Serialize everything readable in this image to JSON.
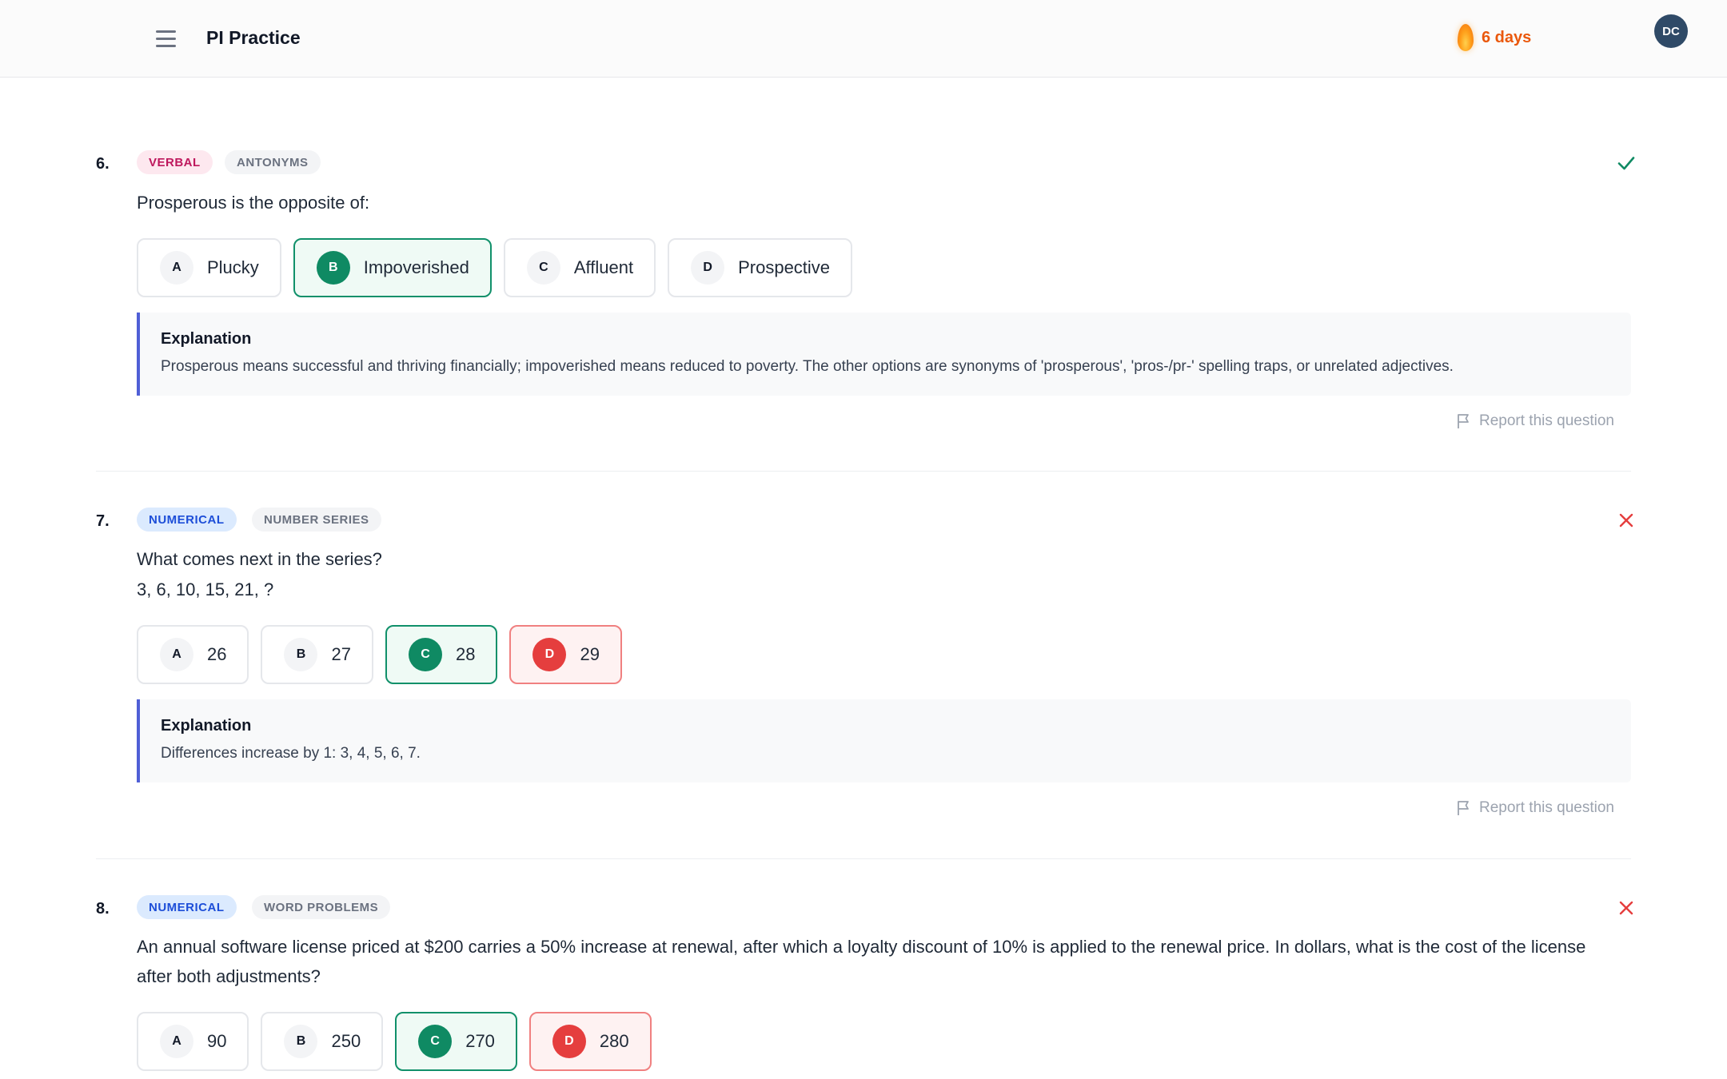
{
  "header": {
    "app_title": "PI Practice",
    "streak_text": "6 days",
    "avatar_initials": "DC"
  },
  "questions": [
    {
      "number": "6.",
      "category": "VERBAL",
      "subcategory": "ANTONYMS",
      "status": "correct",
      "text_lines": [
        "Prosperous is the opposite of:"
      ],
      "options": [
        {
          "letter": "A",
          "text": "Plucky",
          "state": "neutral"
        },
        {
          "letter": "B",
          "text": "Impoverished",
          "state": "correct"
        },
        {
          "letter": "C",
          "text": "Affluent",
          "state": "neutral"
        },
        {
          "letter": "D",
          "text": "Prospective",
          "state": "neutral"
        }
      ],
      "explanation_title": "Explanation",
      "explanation": "Prosperous means successful and thriving financially; impoverished means reduced to poverty. The other options are synonyms of 'prosperous', 'pros-/pr-' spelling traps, or unrelated adjectives.",
      "report_label": "Report this question"
    },
    {
      "number": "7.",
      "category": "NUMERICAL",
      "subcategory": "NUMBER SERIES",
      "status": "incorrect",
      "text_lines": [
        "What comes next in the series?",
        "3, 6, 10, 15, 21, ?"
      ],
      "options": [
        {
          "letter": "A",
          "text": "26",
          "state": "neutral"
        },
        {
          "letter": "B",
          "text": "27",
          "state": "neutral"
        },
        {
          "letter": "C",
          "text": "28",
          "state": "correct"
        },
        {
          "letter": "D",
          "text": "29",
          "state": "wrong"
        }
      ],
      "explanation_title": "Explanation",
      "explanation": "Differences increase by 1: 3, 4, 5, 6, 7.",
      "report_label": "Report this question"
    },
    {
      "number": "8.",
      "category": "NUMERICAL",
      "subcategory": "WORD PROBLEMS",
      "status": "incorrect",
      "text_lines": [
        "An annual software license priced at $200 carries a 50% increase at renewal, after which a loyalty discount of 10% is applied to the renewal price. In dollars, what is the cost of the license",
        "after both adjustments?"
      ],
      "options": [
        {
          "letter": "A",
          "text": "90",
          "state": "neutral"
        },
        {
          "letter": "B",
          "text": "250",
          "state": "neutral"
        },
        {
          "letter": "C",
          "text": "270",
          "state": "correct"
        },
        {
          "letter": "D",
          "text": "280",
          "state": "wrong"
        }
      ]
    }
  ],
  "colors": {
    "correct": "#0f8a63",
    "wrong": "#e53e3e",
    "accent": "#4f5fd6",
    "streak": "#ea580c"
  }
}
